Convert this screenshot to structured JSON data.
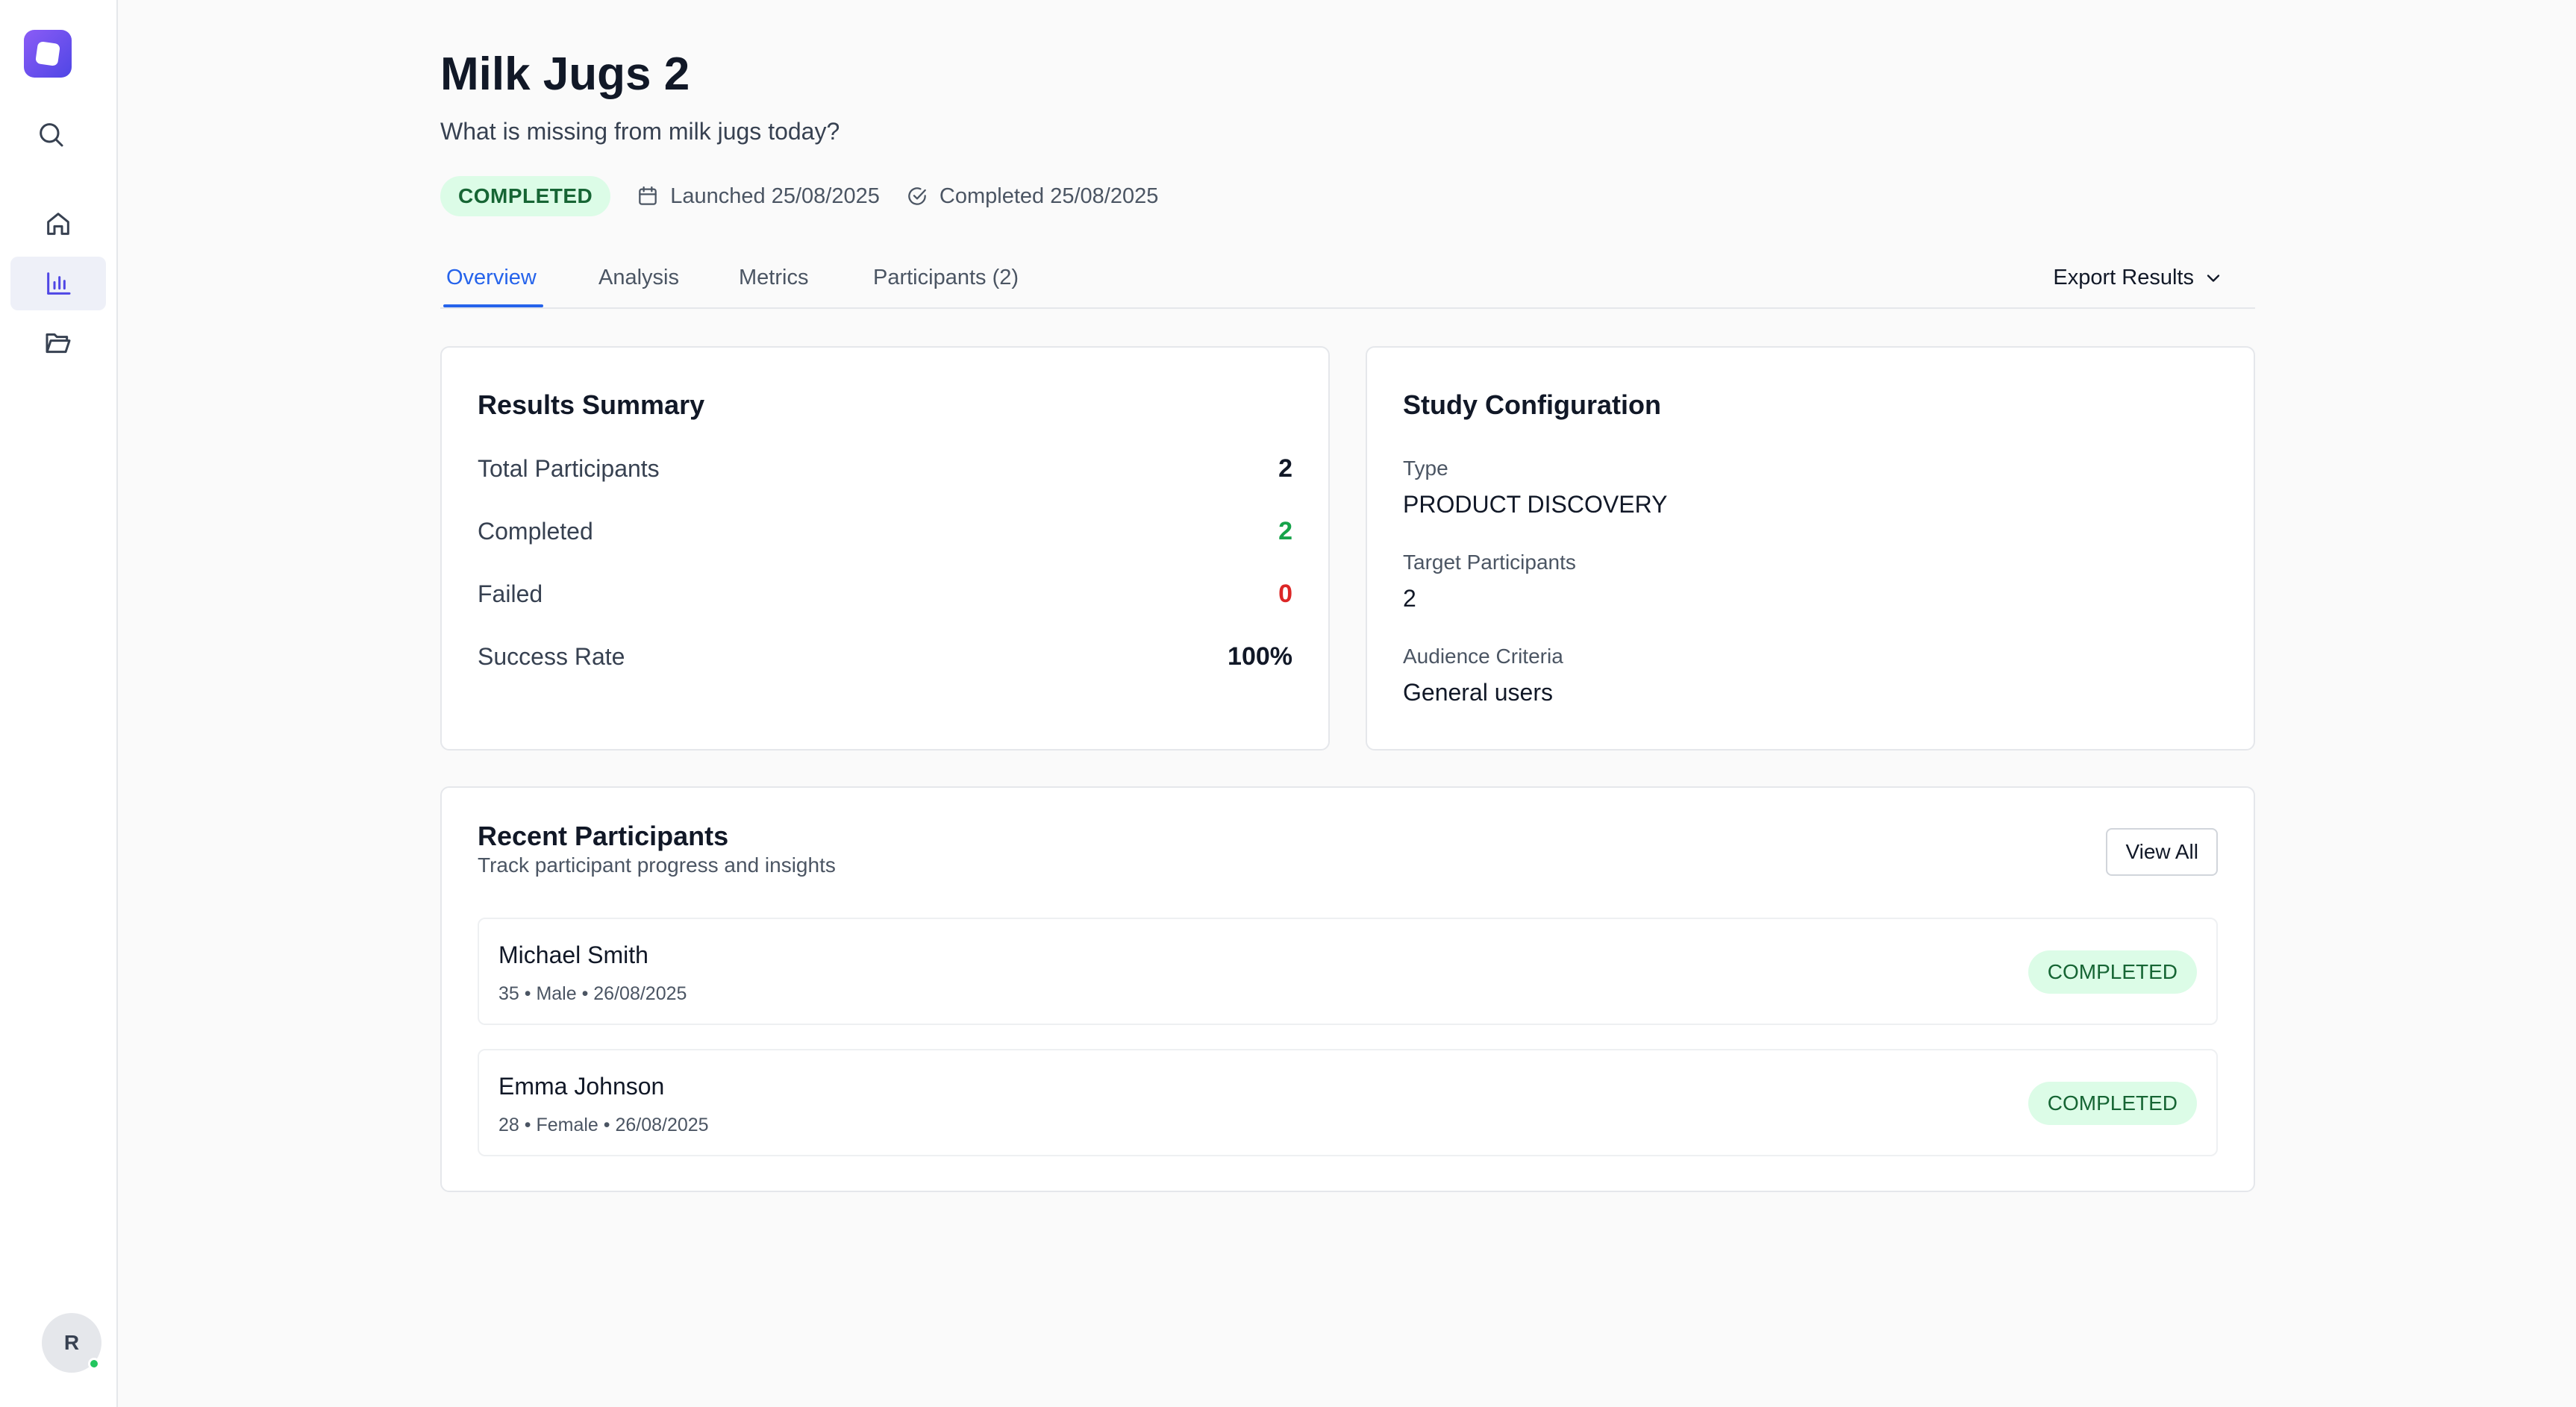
{
  "sidebar": {
    "icons": [
      "app-logo",
      "search-icon",
      "home-icon",
      "bar-chart-icon",
      "folder-open-icon"
    ],
    "avatar_initial": "R"
  },
  "header": {
    "title": "Milk Jugs 2",
    "subtitle": "What is missing from milk jugs today?",
    "status": "COMPLETED",
    "launched": "Launched 25/08/2025",
    "completed": "Completed 25/08/2025"
  },
  "tabs": [
    {
      "label": "Overview",
      "active": true
    },
    {
      "label": "Analysis",
      "active": false
    },
    {
      "label": "Metrics",
      "active": false
    },
    {
      "label": "Participants (2)",
      "active": false
    }
  ],
  "export_label": "Export Results",
  "results_summary": {
    "title": "Results Summary",
    "rows": [
      {
        "label": "Total Participants",
        "value": "2",
        "color": "#111827"
      },
      {
        "label": "Completed",
        "value": "2",
        "color": "#16a34a"
      },
      {
        "label": "Failed",
        "value": "0",
        "color": "#dc2626"
      },
      {
        "label": "Success Rate",
        "value": "100%",
        "color": "#111827"
      }
    ]
  },
  "study_config": {
    "title": "Study Configuration",
    "type_label": "Type",
    "type_value": "PRODUCT DISCOVERY",
    "target_label": "Target Participants",
    "target_value": "2",
    "audience_label": "Audience Criteria",
    "audience_value": "General users"
  },
  "recent_participants": {
    "title": "Recent Participants",
    "subtitle": "Track participant progress and insights",
    "view_all": "View All",
    "items": [
      {
        "name": "Michael Smith",
        "meta": "35 • Male • 26/08/2025",
        "status": "COMPLETED"
      },
      {
        "name": "Emma Johnson",
        "meta": "28 • Female • 26/08/2025",
        "status": "COMPLETED"
      }
    ]
  },
  "colors": {
    "accent": "#2563eb",
    "success_bg": "#dcfce7",
    "success_text": "#166534",
    "brand": "#6d4ee8"
  }
}
